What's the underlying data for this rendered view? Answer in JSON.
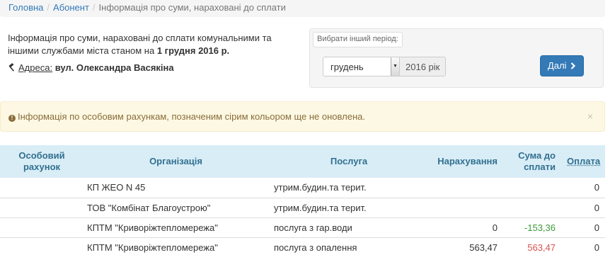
{
  "breadcrumb": {
    "home": "Головна",
    "subscriber": "Абонент",
    "current": "Інформація про суми, нараховані до сплати",
    "separator": "/"
  },
  "intro": {
    "text": "Інформація про суми, нараховані до сплати комунальними та іншими службами міста станом на",
    "date": "1 грудня 2016 р."
  },
  "address": {
    "icon": "hammer-icon",
    "label": "Адреса:",
    "value": "вул. Олександра Васякіна"
  },
  "period": {
    "label": "Вибрати інший період:",
    "month": "грудень",
    "year": "2016 рік",
    "next_label": "Далі",
    "next_icon": "chevron-right-icon"
  },
  "alert": {
    "icon": "info-circle-icon",
    "text": "Інформація по особовим рахункам, позначеним сірим кольором ще не оновлена.",
    "close": "×"
  },
  "table": {
    "headers": {
      "account": "Особовий рахунок",
      "organization": "Організація",
      "service": "Послуга",
      "charges": "Нарахування",
      "amount_due": "Сума до сплати",
      "payment": "Оплата"
    },
    "rows": [
      {
        "organization": "КП ЖЕО N 45",
        "service": "утрим.будин.та терит.",
        "charges": "",
        "amount_due": "",
        "payment": "0"
      },
      {
        "organization": "ТОВ \"Комбінат Благоустрою\"",
        "service": "утрим.будин.та терит.",
        "charges": "",
        "amount_due": "",
        "payment": "0"
      },
      {
        "organization": "КПТМ \"Криворіжтепломережа\"",
        "service": "послуга з гар.води",
        "charges": "0",
        "amount_due": "-153,36",
        "payment": "0"
      },
      {
        "organization": "КПТМ \"Криворіжтепломережа\"",
        "service": "послуга з опалення",
        "charges": "563,47",
        "amount_due": "563,47",
        "payment": "0"
      }
    ]
  },
  "colors": {
    "link": "#337ab7",
    "alert_bg": "#fcf8e3",
    "alert_text": "#8a6d3b",
    "table_header_bg": "#d9edf7",
    "table_header_text": "#31708f",
    "negative_amount": "#3c9a3c",
    "positive_amount": "#d9534f",
    "primary_button": "#337ab7"
  }
}
